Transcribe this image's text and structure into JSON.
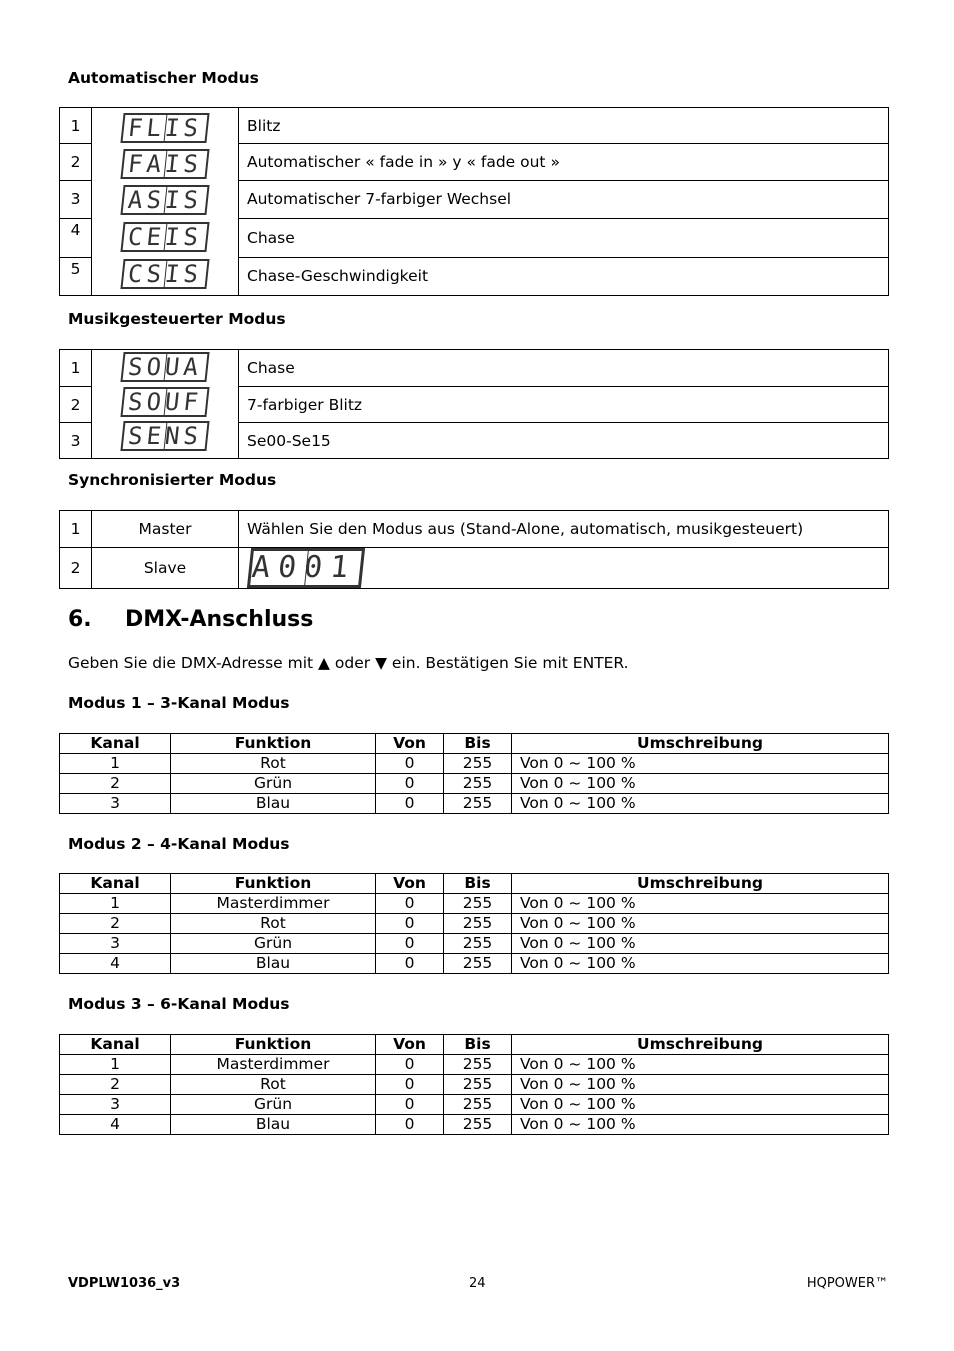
{
  "auto_mode": {
    "title": "Automatischer Modus",
    "rows": [
      {
        "num": "1",
        "display": "FLIS",
        "desc": "Blitz"
      },
      {
        "num": "2",
        "display": "FAIS",
        "desc": "Automatischer « fade  in » y « fade out »"
      },
      {
        "num": "3",
        "display": "ASIS",
        "desc": "Automatischer 7-farbiger Wechsel"
      },
      {
        "num": "4",
        "display": "CEIS",
        "desc": "Chase"
      },
      {
        "num": "5",
        "display": "CSIS",
        "desc": "Chase-Geschwindigkeit"
      }
    ]
  },
  "music_mode": {
    "title": "Musikgesteuerter Modus",
    "rows": [
      {
        "num": "1",
        "display": "SOUA",
        "desc": "Chase"
      },
      {
        "num": "2",
        "display": "SOUF",
        "desc": "7-farbiger Blitz"
      },
      {
        "num": "3",
        "display": "SENS",
        "desc": "Se00-Se15"
      }
    ]
  },
  "sync_mode": {
    "title": "Synchronisierter Modus",
    "rows": [
      {
        "num": "1",
        "role": "Master",
        "desc": "Wählen Sie den Modus aus (Stand-Alone, automatisch, musikgesteuert)"
      },
      {
        "num": "2",
        "role": "Slave",
        "display": "A001"
      }
    ]
  },
  "section": {
    "number": "6.",
    "title": "DMX-Anschluss",
    "intro": "Geben Sie die DMX-Adresse mit ▲ oder ▼ ein. Bestätigen Sie mit ENTER."
  },
  "dmx_headers": [
    "Kanal",
    "Funktion",
    "Von",
    "Bis",
    "Umschreibung"
  ],
  "mode1": {
    "title": "Modus 1 – 3-Kanal Modus",
    "rows": [
      [
        "1",
        "Rot",
        "0",
        "255",
        "Von 0 ~ 100 %"
      ],
      [
        "2",
        "Grün",
        "0",
        "255",
        "Von 0 ~ 100 %"
      ],
      [
        "3",
        "Blau",
        "0",
        "255",
        "Von 0 ~ 100 %"
      ]
    ]
  },
  "mode2": {
    "title": "Modus 2 – 4-Kanal Modus",
    "rows": [
      [
        "1",
        "Masterdimmer",
        "0",
        "255",
        "Von 0 ~ 100 %"
      ],
      [
        "2",
        "Rot",
        "0",
        "255",
        "Von 0 ~ 100 %"
      ],
      [
        "3",
        "Grün",
        "0",
        "255",
        "Von 0 ~ 100 %"
      ],
      [
        "4",
        "Blau",
        "0",
        "255",
        "Von 0 ~ 100 %"
      ]
    ]
  },
  "mode3": {
    "title": "Modus 3 – 6-Kanal Modus",
    "rows": [
      [
        "1",
        "Masterdimmer",
        "0",
        "255",
        "Von 0 ~ 100 %"
      ],
      [
        "2",
        "Rot",
        "0",
        "255",
        "Von 0 ~ 100 %"
      ],
      [
        "3",
        "Grün",
        "0",
        "255",
        "Von 0 ~ 100 %"
      ],
      [
        "4",
        "Blau",
        "0",
        "255",
        "Von 0 ~ 100 %"
      ]
    ]
  },
  "footer": {
    "model": "VDPLW1036_v3",
    "page": "24",
    "brand": "HQPOWER™"
  }
}
